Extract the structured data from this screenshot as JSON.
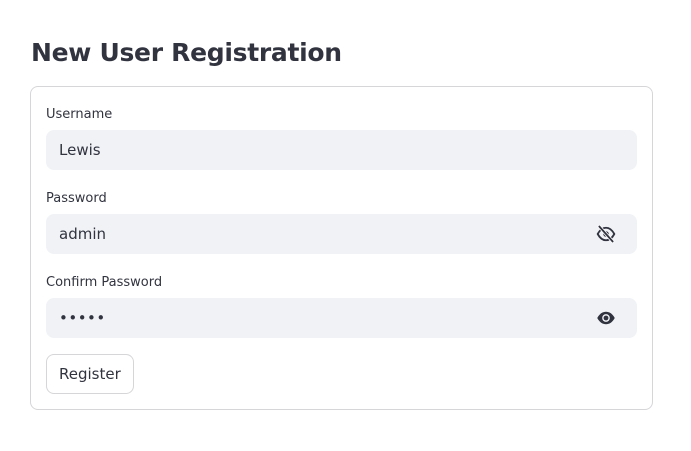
{
  "page": {
    "title": "New User Registration"
  },
  "form": {
    "username": {
      "label": "Username",
      "value": "Lewis"
    },
    "password": {
      "label": "Password",
      "value": "admin",
      "visibility_icon": "eye-off-icon"
    },
    "confirm_password": {
      "label": "Confirm Password",
      "value": "•••••",
      "visibility_icon": "eye-icon"
    },
    "submit_label": "Register"
  },
  "colors": {
    "text": "#31333f",
    "input_background": "#f0f2f6",
    "border": "#d6d6d9"
  }
}
